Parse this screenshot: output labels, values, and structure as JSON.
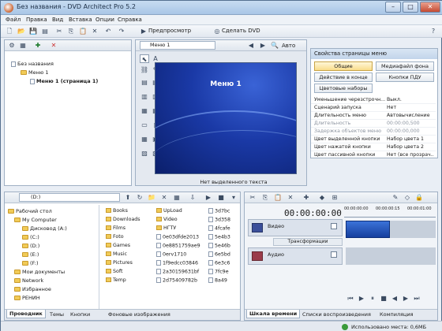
{
  "window": {
    "title": "Без названия - DVD Architect Pro 5.2",
    "controls": [
      "–",
      "□",
      "✕"
    ]
  },
  "menubar": [
    "Файл",
    "Правка",
    "Вид",
    "Вставка",
    "Опции",
    "Справка"
  ],
  "toolbar": {
    "preview_label": "Предпросмотр",
    "make_dvd_label": "Сделать DVD"
  },
  "project_tree": {
    "root": "Без названия",
    "menu": "Меню 1",
    "page": "Меню 1 (страница 1)"
  },
  "editor": {
    "menu_select": "Меню 1",
    "zoom": "Авто",
    "canvas_title": "Меню 1",
    "status": "Нет выделенного текста"
  },
  "properties": {
    "header": "Свойства страницы меню",
    "buttons": [
      "Общие",
      "Медиафайл фона",
      "Действие в конце",
      "Кнопки ПДУ",
      "Цветовые наборы"
    ],
    "rows": [
      {
        "k": "Уменьшение черезстрочн...",
        "v": "Выкл.",
        "dim": false
      },
      {
        "k": "Сценарий запуска",
        "v": "Нет",
        "dim": false
      },
      {
        "k": "Длительность меню",
        "v": "Автовычисление",
        "dim": false
      },
      {
        "k": "Длительность",
        "v": "00:00:00,500",
        "dim": true
      },
      {
        "k": "Задержка объектов меню",
        "v": "00:00:00,000",
        "dim": true
      },
      {
        "k": "Цвет выделенной кнопки",
        "v": "Набор цвета 1",
        "dim": false
      },
      {
        "k": "Цвет нажатой кнопки",
        "v": "Набор цвета 2",
        "dim": false
      },
      {
        "k": "Цвет пассивной кнопки",
        "v": "Нет (все прозрач...",
        "dim": false
      }
    ]
  },
  "explorer": {
    "drive": "(D:)",
    "tree": [
      "Рабочий стол",
      "My Computer",
      "Дисковод (A:)",
      "(C:)",
      "(D:)",
      "(E:)",
      "(F:)",
      "Мои документы",
      "Network",
      "Избранное",
      "РЕНИН"
    ],
    "col1": [
      "Books",
      "Downloads",
      "Films",
      "Foto",
      "Games",
      "Music",
      "Pictures",
      "Soft",
      "Temp"
    ],
    "col2": [
      "UpLoad",
      "Video",
      "НГТУ",
      "0e03dfde2013",
      "0e8851759ae9",
      "0erv1710",
      "1f9edcc03846",
      "2a30159631bf",
      "2d75409782b"
    ],
    "col3": [
      "3d7bc",
      "3d358",
      "4fcafe",
      "5e4b3",
      "5e46b",
      "6e5bd",
      "6e3c6",
      "7fc9e",
      "8a49"
    ],
    "tabs": [
      "Проводник",
      "Темы",
      "Кнопки",
      "Фоновые изображения"
    ]
  },
  "timeline": {
    "timecode": "00:00:00:00",
    "ruler": [
      "00:00:00:00",
      "00:00:00:15",
      "00:00:01:00"
    ],
    "track_video": "Видео",
    "track_transform": "Трансформации",
    "track_audio": "Аудио",
    "tabs": [
      "Шкала времени",
      "Списки воспроизведения",
      "Компиляция"
    ]
  },
  "status": {
    "disk_used": "Использовано места: 0,6МБ"
  }
}
